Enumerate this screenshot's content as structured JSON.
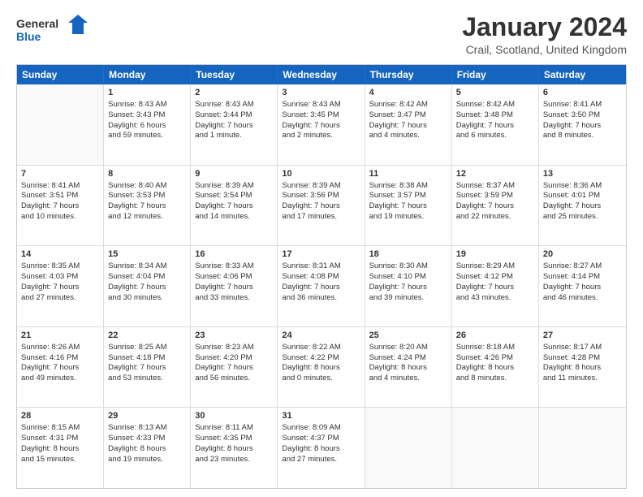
{
  "logo": {
    "line1": "General",
    "line2": "Blue"
  },
  "title": "January 2024",
  "subtitle": "Crail, Scotland, United Kingdom",
  "days_of_week": [
    "Sunday",
    "Monday",
    "Tuesday",
    "Wednesday",
    "Thursday",
    "Friday",
    "Saturday"
  ],
  "weeks": [
    [
      {
        "day": "",
        "info": ""
      },
      {
        "day": "1",
        "info": "Sunrise: 8:43 AM\nSunset: 3:43 PM\nDaylight: 6 hours\nand 59 minutes."
      },
      {
        "day": "2",
        "info": "Sunrise: 8:43 AM\nSunset: 3:44 PM\nDaylight: 7 hours\nand 1 minute."
      },
      {
        "day": "3",
        "info": "Sunrise: 8:43 AM\nSunset: 3:45 PM\nDaylight: 7 hours\nand 2 minutes."
      },
      {
        "day": "4",
        "info": "Sunrise: 8:42 AM\nSunset: 3:47 PM\nDaylight: 7 hours\nand 4 minutes."
      },
      {
        "day": "5",
        "info": "Sunrise: 8:42 AM\nSunset: 3:48 PM\nDaylight: 7 hours\nand 6 minutes."
      },
      {
        "day": "6",
        "info": "Sunrise: 8:41 AM\nSunset: 3:50 PM\nDaylight: 7 hours\nand 8 minutes."
      }
    ],
    [
      {
        "day": "7",
        "info": "Sunrise: 8:41 AM\nSunset: 3:51 PM\nDaylight: 7 hours\nand 10 minutes."
      },
      {
        "day": "8",
        "info": "Sunrise: 8:40 AM\nSunset: 3:53 PM\nDaylight: 7 hours\nand 12 minutes."
      },
      {
        "day": "9",
        "info": "Sunrise: 8:39 AM\nSunset: 3:54 PM\nDaylight: 7 hours\nand 14 minutes."
      },
      {
        "day": "10",
        "info": "Sunrise: 8:39 AM\nSunset: 3:56 PM\nDaylight: 7 hours\nand 17 minutes."
      },
      {
        "day": "11",
        "info": "Sunrise: 8:38 AM\nSunset: 3:57 PM\nDaylight: 7 hours\nand 19 minutes."
      },
      {
        "day": "12",
        "info": "Sunrise: 8:37 AM\nSunset: 3:59 PM\nDaylight: 7 hours\nand 22 minutes."
      },
      {
        "day": "13",
        "info": "Sunrise: 8:36 AM\nSunset: 4:01 PM\nDaylight: 7 hours\nand 25 minutes."
      }
    ],
    [
      {
        "day": "14",
        "info": "Sunrise: 8:35 AM\nSunset: 4:03 PM\nDaylight: 7 hours\nand 27 minutes."
      },
      {
        "day": "15",
        "info": "Sunrise: 8:34 AM\nSunset: 4:04 PM\nDaylight: 7 hours\nand 30 minutes."
      },
      {
        "day": "16",
        "info": "Sunrise: 8:33 AM\nSunset: 4:06 PM\nDaylight: 7 hours\nand 33 minutes."
      },
      {
        "day": "17",
        "info": "Sunrise: 8:31 AM\nSunset: 4:08 PM\nDaylight: 7 hours\nand 36 minutes."
      },
      {
        "day": "18",
        "info": "Sunrise: 8:30 AM\nSunset: 4:10 PM\nDaylight: 7 hours\nand 39 minutes."
      },
      {
        "day": "19",
        "info": "Sunrise: 8:29 AM\nSunset: 4:12 PM\nDaylight: 7 hours\nand 43 minutes."
      },
      {
        "day": "20",
        "info": "Sunrise: 8:27 AM\nSunset: 4:14 PM\nDaylight: 7 hours\nand 46 minutes."
      }
    ],
    [
      {
        "day": "21",
        "info": "Sunrise: 8:26 AM\nSunset: 4:16 PM\nDaylight: 7 hours\nand 49 minutes."
      },
      {
        "day": "22",
        "info": "Sunrise: 8:25 AM\nSunset: 4:18 PM\nDaylight: 7 hours\nand 53 minutes."
      },
      {
        "day": "23",
        "info": "Sunrise: 8:23 AM\nSunset: 4:20 PM\nDaylight: 7 hours\nand 56 minutes."
      },
      {
        "day": "24",
        "info": "Sunrise: 8:22 AM\nSunset: 4:22 PM\nDaylight: 8 hours\nand 0 minutes."
      },
      {
        "day": "25",
        "info": "Sunrise: 8:20 AM\nSunset: 4:24 PM\nDaylight: 8 hours\nand 4 minutes."
      },
      {
        "day": "26",
        "info": "Sunrise: 8:18 AM\nSunset: 4:26 PM\nDaylight: 8 hours\nand 8 minutes."
      },
      {
        "day": "27",
        "info": "Sunrise: 8:17 AM\nSunset: 4:28 PM\nDaylight: 8 hours\nand 11 minutes."
      }
    ],
    [
      {
        "day": "28",
        "info": "Sunrise: 8:15 AM\nSunset: 4:31 PM\nDaylight: 8 hours\nand 15 minutes."
      },
      {
        "day": "29",
        "info": "Sunrise: 8:13 AM\nSunset: 4:33 PM\nDaylight: 8 hours\nand 19 minutes."
      },
      {
        "day": "30",
        "info": "Sunrise: 8:11 AM\nSunset: 4:35 PM\nDaylight: 8 hours\nand 23 minutes."
      },
      {
        "day": "31",
        "info": "Sunrise: 8:09 AM\nSunset: 4:37 PM\nDaylight: 8 hours\nand 27 minutes."
      },
      {
        "day": "",
        "info": ""
      },
      {
        "day": "",
        "info": ""
      },
      {
        "day": "",
        "info": ""
      }
    ]
  ]
}
